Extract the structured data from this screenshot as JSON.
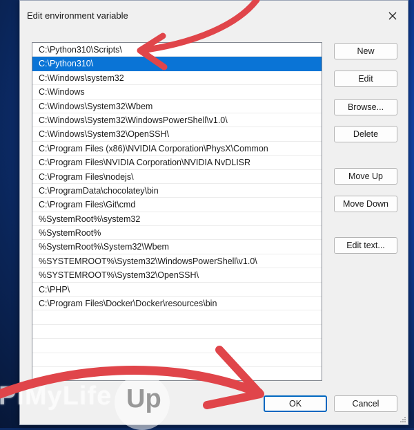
{
  "dialog": {
    "title": "Edit environment variable"
  },
  "list": {
    "selected_index": 1,
    "items": [
      "C:\\Python310\\Scripts\\",
      "C:\\Python310\\",
      "C:\\Windows\\system32",
      "C:\\Windows",
      "C:\\Windows\\System32\\Wbem",
      "C:\\Windows\\System32\\WindowsPowerShell\\v1.0\\",
      "C:\\Windows\\System32\\OpenSSH\\",
      "C:\\Program Files (x86)\\NVIDIA Corporation\\PhysX\\Common",
      "C:\\Program Files\\NVIDIA Corporation\\NVIDIA NvDLISR",
      "C:\\Program Files\\nodejs\\",
      "C:\\ProgramData\\chocolatey\\bin",
      "C:\\Program Files\\Git\\cmd",
      "%SystemRoot%\\system32",
      "%SystemRoot%",
      "%SystemRoot%\\System32\\Wbem",
      "%SYSTEMROOT%\\System32\\WindowsPowerShell\\v1.0\\",
      "%SYSTEMROOT%\\System32\\OpenSSH\\",
      "C:\\PHP\\",
      "C:\\Program Files\\Docker\\Docker\\resources\\bin",
      "",
      "",
      "",
      "",
      ""
    ]
  },
  "buttons": {
    "new": "New",
    "edit": "Edit",
    "browse": "Browse...",
    "delete": "Delete",
    "move_up": "Move Up",
    "move_down": "Move Down",
    "edit_text": "Edit text...",
    "ok": "OK",
    "cancel": "Cancel"
  },
  "watermark": {
    "text": "PiMyLife",
    "badge": "Up"
  },
  "colors": {
    "selection": "#0a74d6",
    "arrow": "#e0454a",
    "ok_border": "#0067c0"
  },
  "icons": {
    "close": "close-icon",
    "resize": "resize-grip-icon"
  }
}
